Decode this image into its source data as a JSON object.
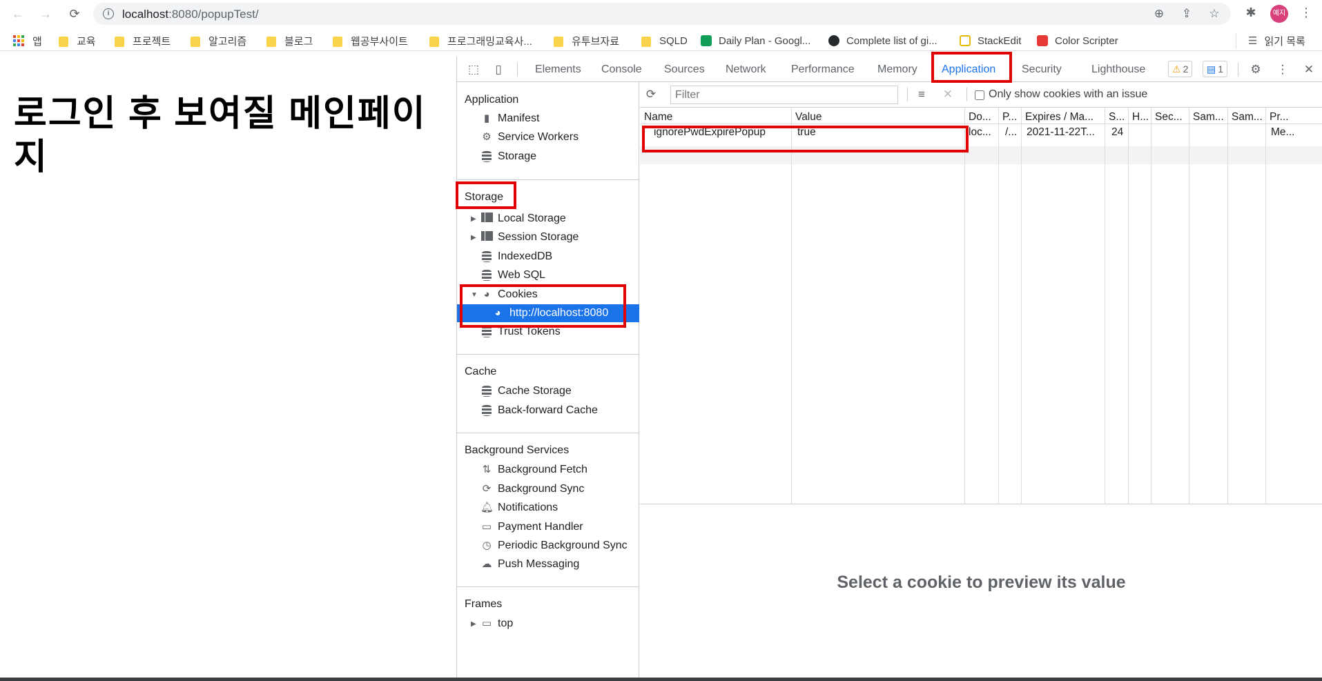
{
  "browser": {
    "url_host": "localhost",
    "url_rest": ":8080/popupTest/",
    "avatar_text": "예지"
  },
  "bookmarks": {
    "apps_label": "앱",
    "items": [
      {
        "label": "교육"
      },
      {
        "label": "프로젝트"
      },
      {
        "label": "알고리즘"
      },
      {
        "label": "블로그"
      },
      {
        "label": "웹공부사이트"
      },
      {
        "label": "프로그래밍교육사..."
      },
      {
        "label": "유투브자료"
      },
      {
        "label": "SQLD"
      },
      {
        "label": "Daily Plan - Googl..."
      },
      {
        "label": "Complete list of gi..."
      },
      {
        "label": "StackEdit"
      },
      {
        "label": "Color Scripter"
      }
    ],
    "reading_list": "읽기 목록"
  },
  "page": {
    "heading": "로그인 후 보여질 메인페이지"
  },
  "devtools": {
    "tabs": [
      "Elements",
      "Console",
      "Sources",
      "Network",
      "Performance",
      "Memory",
      "Application",
      "Security",
      "Lighthouse"
    ],
    "active_tab": "Application",
    "warnings_count": "2",
    "messages_count": "1",
    "sidebar": {
      "application_title": "Application",
      "application_items": [
        "Manifest",
        "Service Workers",
        "Storage"
      ],
      "storage_title": "Storage",
      "storage_items": [
        "Local Storage",
        "Session Storage",
        "IndexedDB",
        "Web SQL",
        "Cookies",
        "http://localhost:8080",
        "Trust Tokens"
      ],
      "cache_title": "Cache",
      "cache_items": [
        "Cache Storage",
        "Back-forward Cache"
      ],
      "bg_title": "Background Services",
      "bg_items": [
        "Background Fetch",
        "Background Sync",
        "Notifications",
        "Payment Handler",
        "Periodic Background Sync",
        "Push Messaging"
      ],
      "frames_title": "Frames",
      "frames_items": [
        "top"
      ]
    },
    "filter_placeholder": "Filter",
    "only_issue_label": "Only show cookies with an issue",
    "table": {
      "headers": [
        "Name",
        "Value",
        "Do...",
        "P...",
        "Expires / Ma...",
        "S...",
        "H...",
        "Sec...",
        "Sam...",
        "Sam...",
        "Pr..."
      ],
      "rows": [
        [
          "ignorePwdExpirePopup",
          "true",
          "loc...",
          "/...",
          "2021-11-22T...",
          "24",
          "",
          "",
          "",
          "",
          "Me..."
        ]
      ]
    },
    "preview_text": "Select a cookie to preview its value"
  },
  "colors": {
    "accent": "#1a73e8",
    "highlight_box": "#e00000"
  }
}
